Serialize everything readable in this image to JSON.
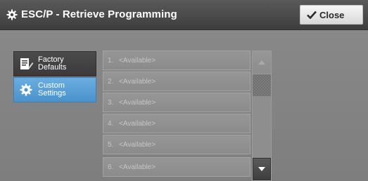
{
  "header": {
    "title": "ESC/P - Retrieve Programming",
    "title_icon": "gear-icon",
    "close_label": "Close",
    "close_icon": "checkmark-icon"
  },
  "menu": {
    "items": [
      {
        "label": "Factory\nDefaults",
        "icon": "document-pencil-icon",
        "selected": false
      },
      {
        "label": "Custom\nSettings",
        "icon": "gear-icon",
        "selected": true
      }
    ]
  },
  "list": {
    "rows": [
      {
        "number": "1.",
        "text": "<Available>"
      },
      {
        "number": "2.",
        "text": "<Available>"
      },
      {
        "number": "3.",
        "text": "<Available>"
      },
      {
        "number": "4.",
        "text": "<Available>"
      },
      {
        "number": "5.",
        "text": "<Available>"
      },
      {
        "number": "6.",
        "text": "<Available>"
      }
    ]
  },
  "scrollbar": {
    "up_enabled": false,
    "down_enabled": true
  },
  "colors": {
    "header_bg": "#4a4a4a",
    "selected_accent": "#5aa0d8",
    "body_bg": "#838383"
  }
}
